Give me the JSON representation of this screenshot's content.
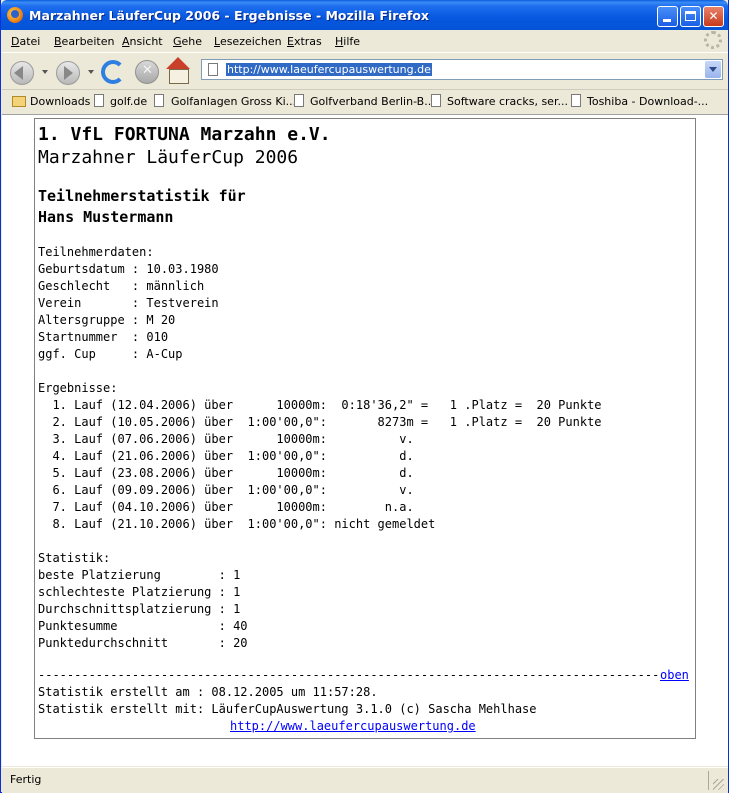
{
  "window": {
    "title": "Marzahner LäuferCup 2006 - Ergebnisse - Mozilla Firefox"
  },
  "menu": [
    "Datei",
    "Bearbeiten",
    "Ansicht",
    "Gehe",
    "Lesezeichen",
    "Extras",
    "Hilfe"
  ],
  "toolbar": {
    "url": "http://www.laeufercupauswertung.de"
  },
  "bookmarks": [
    "Downloads",
    "golf.de",
    "Golfanlagen Gross Ki...",
    "Golfverband Berlin-B...",
    "Software cracks, ser...",
    "Toshiba - Download-..."
  ],
  "page": {
    "club": "1. VfL FORTUNA Marzahn e.V.",
    "event": "Marzahner LäuferCup 2006",
    "stat_title_1": "Teilnehmerstatistik für",
    "stat_title_2": "Hans Mustermann",
    "participant_header": "Teilnehmerdaten:",
    "participant_lines": [
      "Geburtsdatum : 10.03.1980",
      "Geschlecht   : männlich",
      "Verein       : Testverein",
      "Altersgruppe : M 20",
      "Startnummer  : 010",
      "ggf. Cup     : A-Cup"
    ],
    "results_header": "Ergebnisse:",
    "results_lines": [
      "  1. Lauf (12.04.2006) über      10000m:  0:18'36,2\" =   1 .Platz =  20 Punkte",
      "  2. Lauf (10.05.2006) über  1:00'00,0\":       8273m =   1 .Platz =  20 Punkte",
      "  3. Lauf (07.06.2006) über      10000m:          v.",
      "  4. Lauf (21.06.2006) über  1:00'00,0\":          d.",
      "  5. Lauf (23.08.2006) über      10000m:          d.",
      "  6. Lauf (09.09.2006) über  1:00'00,0\":          v.",
      "  7. Lauf (04.10.2006) über      10000m:        n.a.",
      "  8. Lauf (21.10.2006) über  1:00'00,0\": nicht gemeldet"
    ],
    "stats_header": "Statistik:",
    "stats_lines": [
      "beste Platzierung        : 1",
      "schlechteste Platzierung : 1",
      "Durchschnittsplatzierung : 1",
      "Punktesumme              : 40",
      "Punktedurchschnitt       : 20"
    ],
    "rule": "-----------------------------------------------------------------------------------------------",
    "top_link": "oben",
    "footer_1": "Statistik erstellt am : 08.12.2005 um 11:57:28.",
    "footer_2": "Statistik erstellt mit: LäuferCupAuswertung 3.1.0 (c) Sascha Mehlhase",
    "footer_link": "http://www.laeufercupauswertung.de"
  },
  "status": {
    "text": "Fertig"
  }
}
